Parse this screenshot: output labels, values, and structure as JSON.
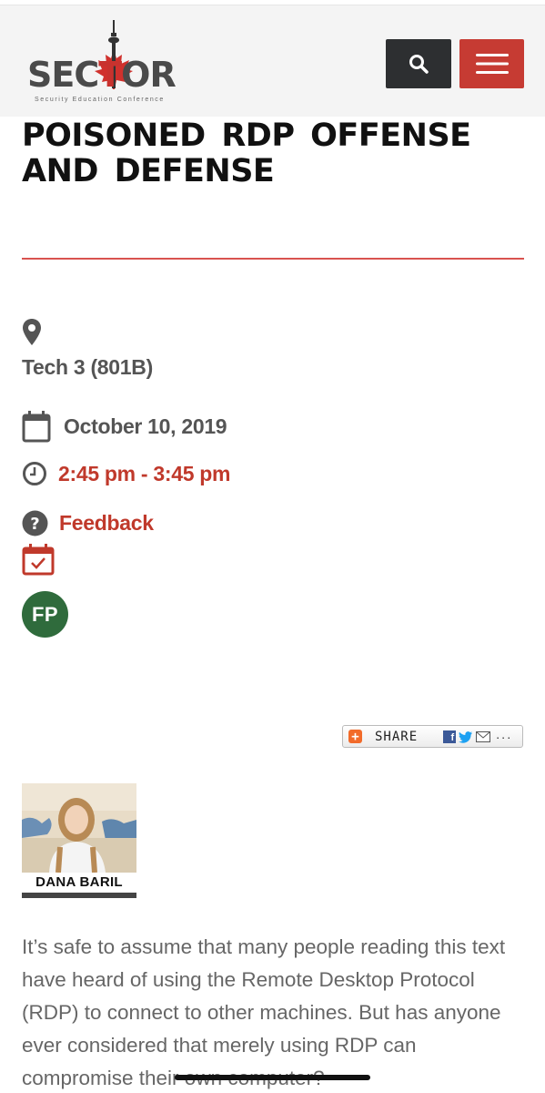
{
  "header": {
    "logo_main_left": "SEC",
    "logo_main_mid": "T",
    "logo_main_right": "OR",
    "logo_tagline": "Security Education Conference",
    "search_icon": "search-icon",
    "menu_icon": "hamburger-menu-icon",
    "colors": {
      "menu_red": "#c63b33",
      "search_dark": "#2d2f31"
    }
  },
  "session": {
    "title": "POISONED RDP OFFENSE AND DEFENSE",
    "location_icon": "map-pin-icon",
    "location": "Tech 3 (801B)",
    "date_icon": "calendar-icon",
    "date": "October 10, 2019",
    "time_icon": "clock-icon",
    "time": "2:45 pm - 3:45 pm",
    "feedback_icon": "question-circle-icon",
    "feedback": "Feedback",
    "add_calendar_icon": "calendar-check-icon",
    "track_badge": "FP",
    "accent_color": "#c0392b"
  },
  "share": {
    "label": "SHARE",
    "fb": "f",
    "more": "..."
  },
  "speaker": {
    "name": "DANA BARIL"
  },
  "description": "It’s safe to assume that many people reading this text have heard of using the Remote Desktop Protocol (RDP) to connect to other machines. But has anyone ever considered that merely using RDP can compromise their own computer?"
}
